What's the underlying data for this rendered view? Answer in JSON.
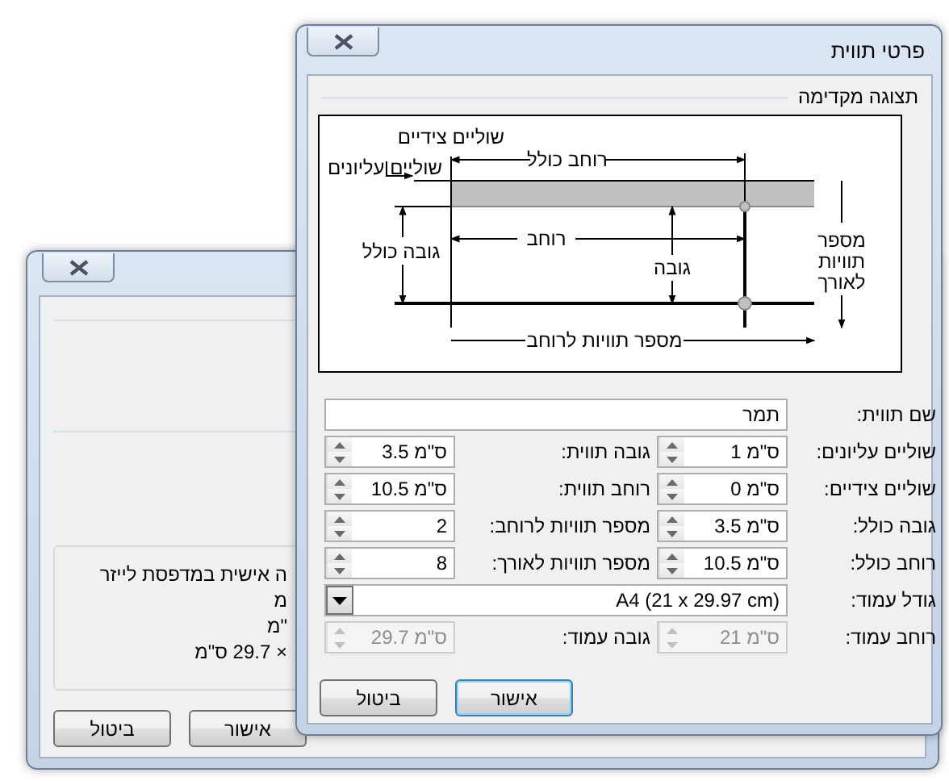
{
  "background_dialog": {
    "summary_lines": [
      "ה אישית במדפסת לייזר",
      "מ",
      "\"מ",
      "× 29.7 ס\"מ"
    ],
    "buttons": [
      {
        "label": "אישור"
      },
      {
        "label": "ביטול"
      }
    ]
  },
  "dialog": {
    "title": "פרטי תווית",
    "preview": {
      "title": "תצוגה מקדימה",
      "labels": [
        "שוליים צידיים",
        "שוליים עליונים",
        "רוחב כולל",
        "גובה כולל",
        "רוחב",
        "גובה",
        "מספר תוויות לאורך",
        "מספר תוויות לרוחב"
      ]
    },
    "fields": [
      {
        "kind": "text",
        "label": "שם תווית:",
        "value": "תמר",
        "disabled": false
      },
      {
        "kind": "spin",
        "label": "שוליים עליונים:",
        "value": "1 ס\"מ",
        "disabled": false
      },
      {
        "kind": "spin",
        "label": "גובה תווית:",
        "value": "3.5 ס\"מ",
        "disabled": false
      },
      {
        "kind": "spin",
        "label": "שוליים צידיים:",
        "value": "0 ס\"מ",
        "disabled": false
      },
      {
        "kind": "spin",
        "label": "רוחב תווית:",
        "value": "10.5 ס\"מ",
        "disabled": false
      },
      {
        "kind": "spin",
        "label": "גובה כולל:",
        "value": "3.5 ס\"מ",
        "disabled": false
      },
      {
        "kind": "spin",
        "label": "מספר תוויות לרוחב:",
        "value": "2",
        "disabled": false
      },
      {
        "kind": "spin",
        "label": "רוחב כולל:",
        "value": "10.5 ס\"מ",
        "disabled": false
      },
      {
        "kind": "spin",
        "label": "מספר תוויות לאורך:",
        "value": "8",
        "disabled": false
      },
      {
        "kind": "combo",
        "label": "גודל עמוד:",
        "value": "A4 (21 x 29.97 cm)",
        "disabled": false
      },
      {
        "kind": "spin",
        "label": "רוחב עמוד:",
        "value": "21 ס\"מ",
        "disabled": true
      },
      {
        "kind": "spin",
        "label": "גובה עמוד:",
        "value": "29.7 ס\"מ",
        "disabled": true
      }
    ],
    "buttons": [
      {
        "label": "אישור",
        "default": true
      },
      {
        "label": "ביטול",
        "default": false
      }
    ]
  }
}
